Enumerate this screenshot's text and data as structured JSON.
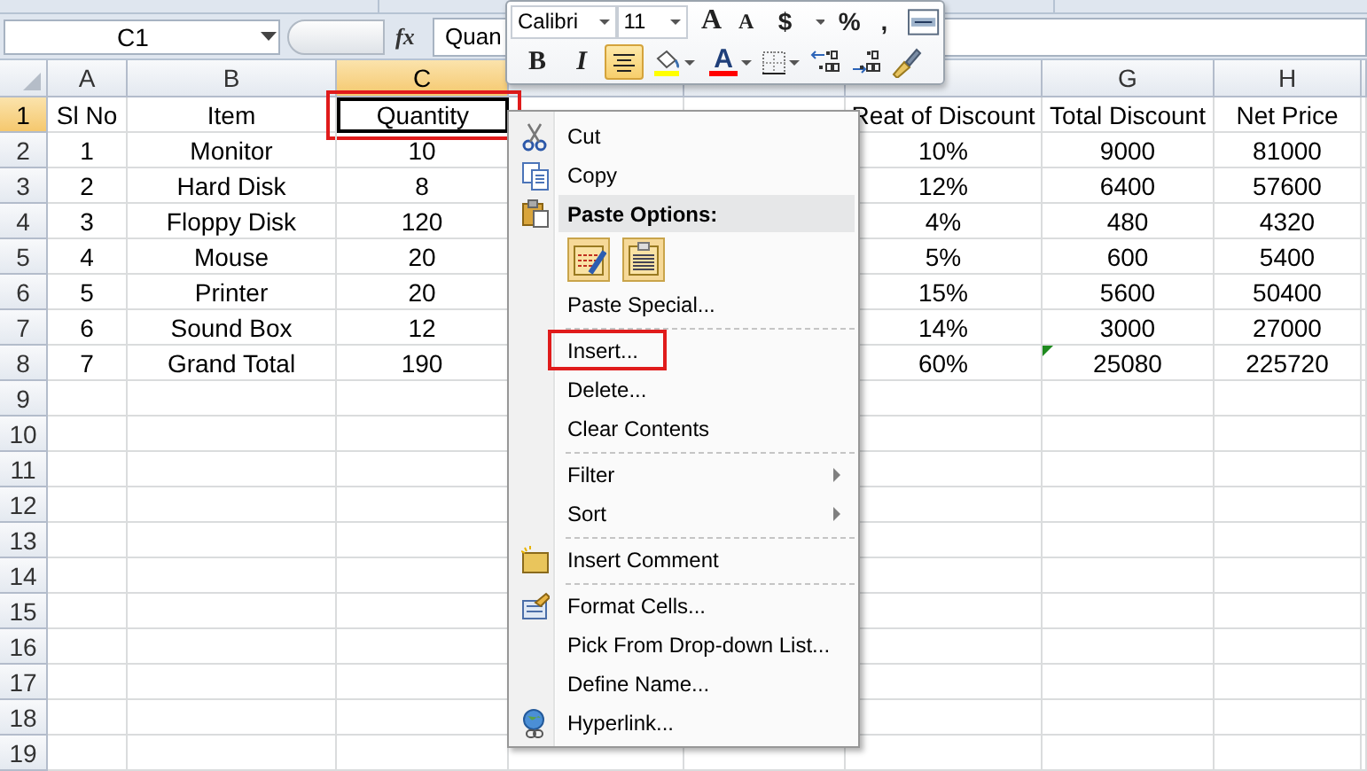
{
  "formula_bar": {
    "name_box": "C1",
    "function_label": "fx",
    "formula": "Quan"
  },
  "sheet": {
    "columns": [
      {
        "label": "A",
        "selected": false
      },
      {
        "label": "B",
        "selected": false
      },
      {
        "label": "C",
        "selected": true
      },
      {
        "label": "G",
        "selected": false
      },
      {
        "label": "H",
        "selected": false
      }
    ],
    "rows": [
      {
        "number": "1",
        "selected": true,
        "cells": [
          "Sl No",
          "Item",
          "Quantity",
          "Reat of Discount",
          "Total Discount",
          "Net Price"
        ]
      },
      {
        "number": "2",
        "selected": false,
        "cells": [
          "1",
          "Monitor",
          "10",
          "10%",
          "9000",
          "81000"
        ]
      },
      {
        "number": "3",
        "selected": false,
        "cells": [
          "2",
          "Hard Disk",
          "8",
          "12%",
          "6400",
          "57600"
        ]
      },
      {
        "number": "4",
        "selected": false,
        "cells": [
          "3",
          "Floppy Disk",
          "120",
          "4%",
          "480",
          "4320"
        ]
      },
      {
        "number": "5",
        "selected": false,
        "cells": [
          "4",
          "Mouse",
          "20",
          "5%",
          "600",
          "5400"
        ]
      },
      {
        "number": "6",
        "selected": false,
        "cells": [
          "5",
          "Printer",
          "20",
          "15%",
          "5600",
          "50400"
        ]
      },
      {
        "number": "7",
        "selected": false,
        "cells": [
          "6",
          "Sound Box",
          "12",
          "14%",
          "3000",
          "27000"
        ]
      },
      {
        "number": "8",
        "selected": false,
        "cells": [
          "7",
          "Grand Total",
          "190",
          "60%",
          "25080",
          "225720"
        ],
        "error_mark": true
      },
      {
        "number": "9",
        "selected": false
      },
      {
        "number": "10",
        "selected": false
      },
      {
        "number": "11",
        "selected": false
      },
      {
        "number": "12",
        "selected": false
      },
      {
        "number": "13",
        "selected": false
      },
      {
        "number": "14",
        "selected": false
      },
      {
        "number": "15",
        "selected": false
      },
      {
        "number": "16",
        "selected": false
      },
      {
        "number": "17",
        "selected": false
      },
      {
        "number": "18",
        "selected": false
      },
      {
        "number": "19",
        "selected": false
      }
    ],
    "active_cell_outlined": true
  },
  "mini_toolbar": {
    "rows": [
      [
        {
          "kind": "font",
          "value": "Calibri"
        },
        {
          "kind": "size",
          "value": "11"
        },
        {
          "kind": "grow",
          "text": "A"
        },
        {
          "kind": "shrink",
          "text": "A"
        },
        {
          "kind": "currency",
          "text": "$"
        },
        {
          "kind": "percent",
          "text": "%"
        },
        {
          "kind": "comma",
          "text": ","
        },
        {
          "kind": "merge"
        }
      ],
      [
        {
          "kind": "bold",
          "text": "B",
          "selected": false
        },
        {
          "kind": "italic",
          "text": "I",
          "selected": false
        },
        {
          "kind": "align",
          "selected": true
        },
        {
          "kind": "fill",
          "color": "#ffff00"
        },
        {
          "kind": "fontcolor",
          "text": "A",
          "color": "#ff0000"
        },
        {
          "kind": "borders"
        },
        {
          "kind": "incdec"
        },
        {
          "kind": "decdec"
        },
        {
          "kind": "painter"
        }
      ]
    ]
  },
  "context_menu": {
    "items": [
      {
        "kind": "item",
        "label": "Cut",
        "outlined": false
      },
      {
        "kind": "item",
        "label": "Copy",
        "outlined": false
      },
      {
        "kind": "header",
        "label": "Paste Options:"
      },
      {
        "kind": "paste_options"
      },
      {
        "kind": "item",
        "label": "Paste Special...",
        "outlined": false
      },
      {
        "kind": "separator"
      },
      {
        "kind": "item",
        "label": "Insert...",
        "outlined": true
      },
      {
        "kind": "item",
        "label": "Delete...",
        "outlined": false
      },
      {
        "kind": "item",
        "label": "Clear Contents",
        "outlined": false
      },
      {
        "kind": "separator"
      },
      {
        "kind": "item",
        "label": "Filter",
        "submenu": true,
        "outlined": false
      },
      {
        "kind": "item",
        "label": "Sort",
        "submenu": true,
        "outlined": false
      },
      {
        "kind": "separator"
      },
      {
        "kind": "item",
        "label": "Insert Comment",
        "outlined": false
      },
      {
        "kind": "separator"
      },
      {
        "kind": "item",
        "label": "Format Cells...",
        "outlined": false
      },
      {
        "kind": "item",
        "label": "Pick From Drop-down List...",
        "outlined": false
      },
      {
        "kind": "item",
        "label": "Define Name...",
        "outlined": false
      },
      {
        "kind": "item",
        "label": "Hyperlink...",
        "outlined": false
      }
    ]
  }
}
